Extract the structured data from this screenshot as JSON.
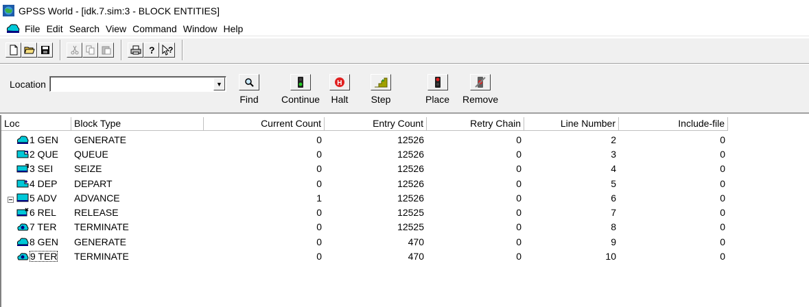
{
  "window": {
    "title": "GPSS World - [idk.7.sim:3  -  BLOCK ENTITIES]"
  },
  "menu": {
    "items": [
      "File",
      "Edit",
      "Search",
      "View",
      "Command",
      "Window",
      "Help"
    ]
  },
  "toolbar": {
    "icons": [
      "new-file-icon",
      "open-folder-icon",
      "save-icon",
      "cut-icon",
      "copy-icon",
      "paste-icon",
      "print-icon",
      "help-icon",
      "context-help-icon"
    ]
  },
  "commandbar": {
    "location_label": "Location",
    "location_value": "",
    "buttons": {
      "find": "Find",
      "continue": "Continue",
      "halt": "Halt",
      "step": "Step",
      "place": "Place",
      "remove": "Remove"
    }
  },
  "table": {
    "columns": {
      "loc": "Loc",
      "block_type": "Block Type",
      "current_count": "Current Count",
      "entry_count": "Entry Count",
      "retry_chain": "Retry Chain",
      "line_number": "Line Number",
      "include_file": "Include-file"
    },
    "rows": [
      {
        "loc": "1 GEN",
        "icon": "generate-icon",
        "block_type": "GENERATE",
        "current_count": "0",
        "entry_count": "12526",
        "retry_chain": "0",
        "line_number": "2",
        "include_file": "0"
      },
      {
        "loc": "2 QUE",
        "icon": "queue-icon",
        "block_type": "QUEUE",
        "current_count": "0",
        "entry_count": "12526",
        "retry_chain": "0",
        "line_number": "3",
        "include_file": "0"
      },
      {
        "loc": "3 SEI",
        "icon": "seize-icon",
        "block_type": "SEIZE",
        "current_count": "0",
        "entry_count": "12526",
        "retry_chain": "0",
        "line_number": "4",
        "include_file": "0"
      },
      {
        "loc": "4 DEP",
        "icon": "depart-icon",
        "block_type": "DEPART",
        "current_count": "0",
        "entry_count": "12526",
        "retry_chain": "0",
        "line_number": "5",
        "include_file": "0"
      },
      {
        "loc": "5 ADV",
        "icon": "advance-icon",
        "block_type": "ADVANCE",
        "current_count": "1",
        "entry_count": "12526",
        "retry_chain": "0",
        "line_number": "6",
        "include_file": "0"
      },
      {
        "loc": "6 REL",
        "icon": "release-icon",
        "block_type": "RELEASE",
        "current_count": "0",
        "entry_count": "12525",
        "retry_chain": "0",
        "line_number": "7",
        "include_file": "0"
      },
      {
        "loc": "7 TER",
        "icon": "terminate-icon",
        "block_type": "TERMINATE",
        "current_count": "0",
        "entry_count": "12525",
        "retry_chain": "0",
        "line_number": "8",
        "include_file": "0"
      },
      {
        "loc": "8 GEN",
        "icon": "generate-icon",
        "block_type": "GENERATE",
        "current_count": "0",
        "entry_count": "470",
        "retry_chain": "0",
        "line_number": "9",
        "include_file": "0"
      },
      {
        "loc": "9 TER",
        "icon": "terminate-icon",
        "block_type": "TERMINATE",
        "current_count": "0",
        "entry_count": "470",
        "retry_chain": "0",
        "line_number": "10",
        "include_file": "0"
      }
    ]
  },
  "colors": {
    "block_icon": "#00c8d8",
    "block_icon_dark": "#000080"
  }
}
